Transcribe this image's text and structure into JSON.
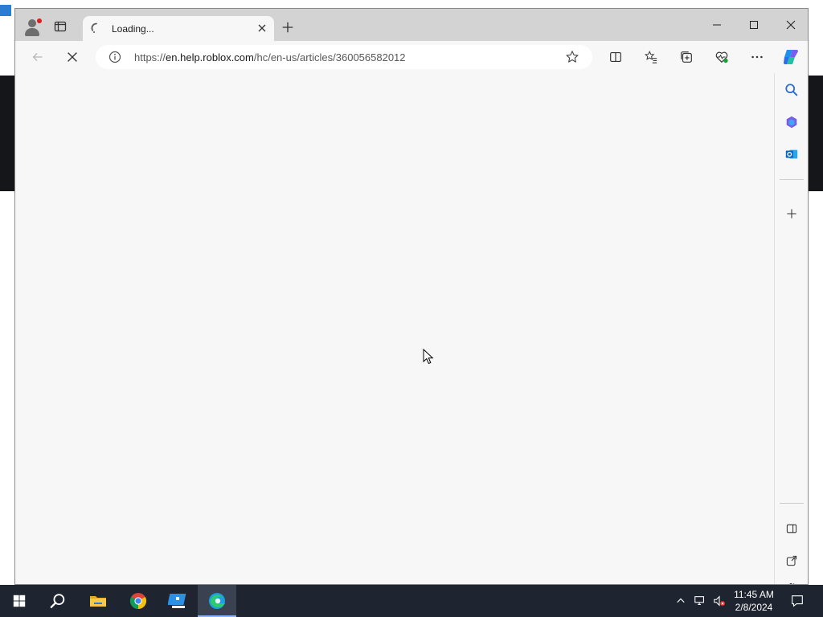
{
  "browser": {
    "tab": {
      "title": "Loading..."
    },
    "address_bar": {
      "url_prefix": "https://",
      "url_host": "en.help.roblox.com",
      "url_path": "/hc/en-us/articles/360056582012"
    }
  },
  "taskbar": {
    "clock": {
      "time": "11:45 AM",
      "date": "2/8/2024"
    },
    "pinned": [
      "start-icon",
      "search-icon",
      "file-explorer-icon",
      "chrome-icon",
      "roblox-icon",
      "edge-icon"
    ]
  },
  "colors": {
    "tabstrip": "#d3d3d3",
    "page_bg": "#f7f7f7",
    "taskbar": "#1e2530",
    "accent": "#0078d4"
  }
}
